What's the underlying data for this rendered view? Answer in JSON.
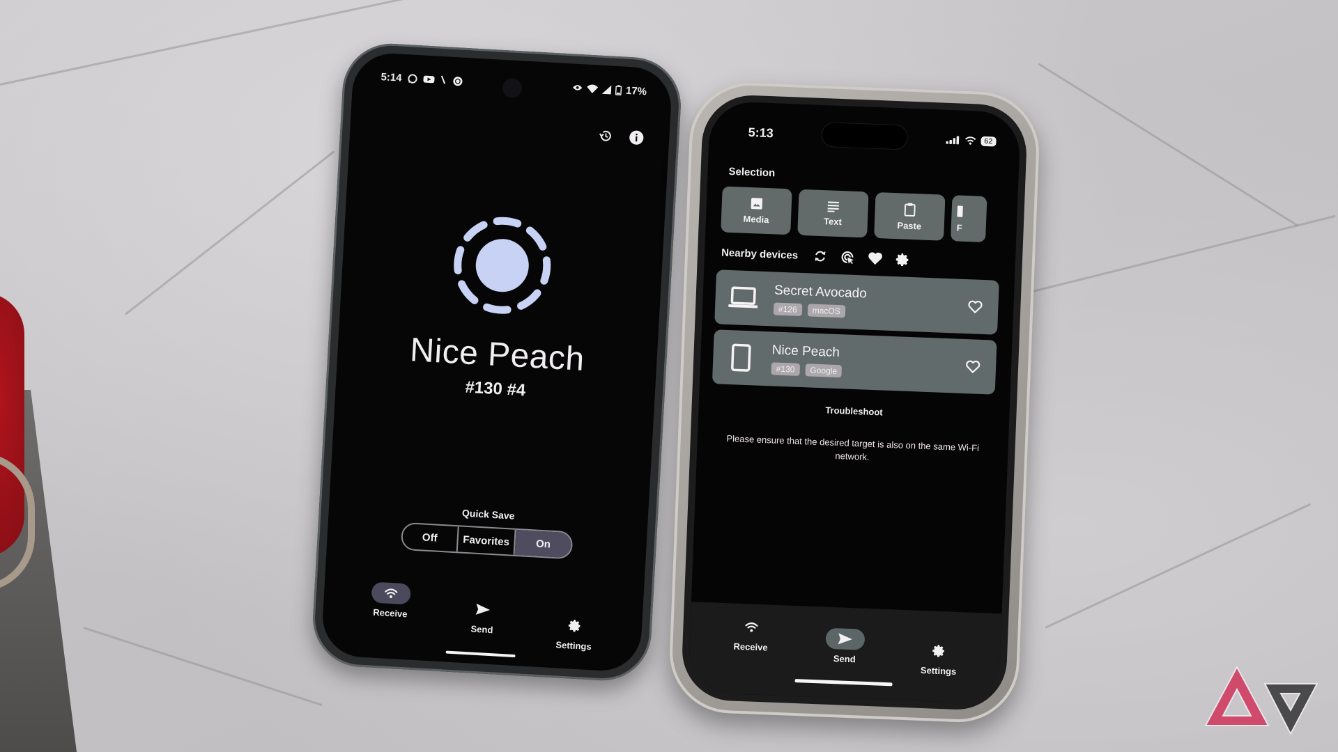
{
  "colors": {
    "android_accent": "#c7d2f5",
    "android_segment_active": "#4e4c5e",
    "ios_card": "#626b6b",
    "ios_tag": "#aca7ab",
    "watermark_pink": "#d04a6c",
    "watermark_dark": "#4a4a4c"
  },
  "android_phone": {
    "status_bar": {
      "time": "5:14",
      "left_icons": [
        "whatsapp-icon",
        "youtube-icon",
        "slash-icon",
        "target-icon"
      ],
      "right_icons": [
        "eye-icon",
        "wifi-icon",
        "cell-signal-icon",
        "battery-icon"
      ],
      "battery": "17%"
    },
    "top_actions": [
      "history-icon",
      "info-icon"
    ],
    "device": {
      "name": "Nice Peach",
      "id": "#130 #4"
    },
    "quick_save": {
      "label": "Quick Save",
      "options": [
        "Off",
        "Favorites",
        "On"
      ],
      "selected": "On"
    },
    "nav": [
      {
        "label": "Receive",
        "icon": "wifi-icon",
        "active": true
      },
      {
        "label": "Send",
        "icon": "send-icon",
        "active": false
      },
      {
        "label": "Settings",
        "icon": "gear-icon",
        "active": false
      }
    ]
  },
  "ios_phone": {
    "status_bar": {
      "time": "5:13",
      "battery": "62"
    },
    "selection": {
      "title": "Selection",
      "buttons": [
        {
          "label": "Media",
          "icon": "image-icon"
        },
        {
          "label": "Text",
          "icon": "text-lines-icon"
        },
        {
          "label": "Paste",
          "icon": "clipboard-icon"
        },
        {
          "label": "F",
          "icon": "file-icon"
        }
      ]
    },
    "nearby": {
      "title": "Nearby devices",
      "actions": [
        "refresh-icon",
        "scan-icon",
        "favorites-icon",
        "gear-icon"
      ],
      "devices": [
        {
          "name": "Secret Avocado",
          "type": "laptop-icon",
          "tags": [
            "#126",
            "macOS"
          ],
          "favorite": false
        },
        {
          "name": "Nice Peach",
          "type": "phone-icon",
          "tags": [
            "#130",
            "Google"
          ],
          "favorite": false
        }
      ]
    },
    "troubleshoot": {
      "label": "Troubleshoot",
      "hint": "Please ensure that the desired target is also on the same Wi-Fi network."
    },
    "nav": [
      {
        "label": "Receive",
        "icon": "wifi-icon",
        "active": false
      },
      {
        "label": "Send",
        "icon": "send-icon",
        "active": true
      },
      {
        "label": "Settings",
        "icon": "gear-icon",
        "active": false
      }
    ]
  },
  "watermark": {
    "name": "Android Police logo"
  }
}
